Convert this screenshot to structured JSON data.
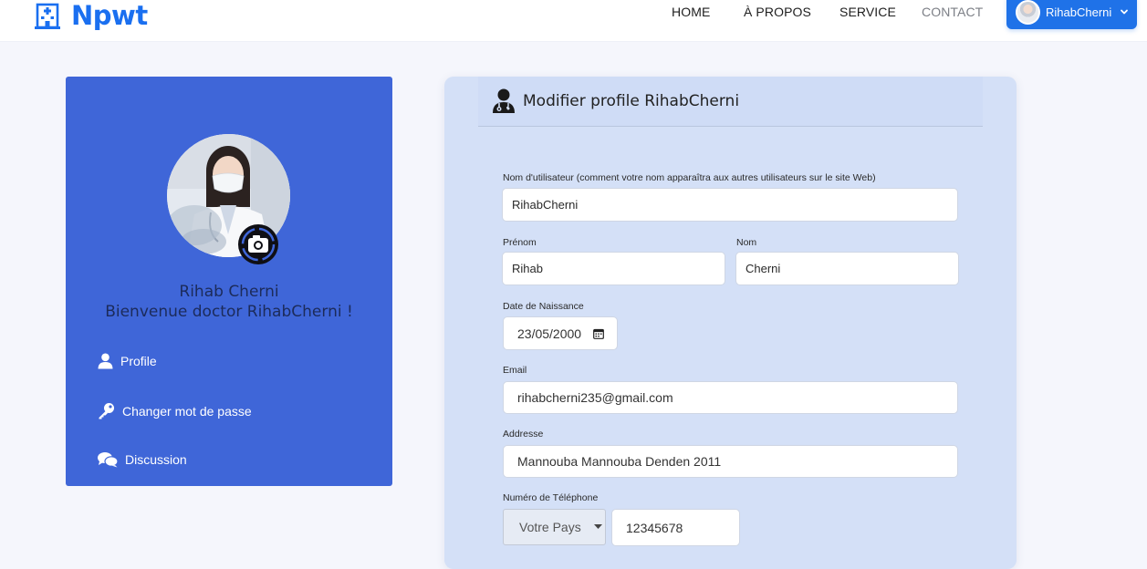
{
  "brand": {
    "name": "Npwt",
    "icon": "hospital-building-icon",
    "color": "#1a6ff0"
  },
  "nav": {
    "links": [
      {
        "label": "HOME"
      },
      {
        "label": "À PROPOS"
      },
      {
        "label": "SERVICE"
      },
      {
        "label": "CONTACT"
      }
    ],
    "user": {
      "name": "RihabCherni",
      "avatar": "user-avatar",
      "chevron": "chevron-down-icon",
      "color": "#1f72e8"
    }
  },
  "sidebar": {
    "background": "#3f66d8",
    "photo": "profile-photo",
    "camera_icon": "camera-icon",
    "name": "Rihab Cherni",
    "welcome": "Bienvenue doctor RihabCherni !",
    "items": [
      {
        "label": "Profile",
        "icon": "user-icon"
      },
      {
        "label": "Changer mot de passe",
        "icon": "key-icon"
      },
      {
        "label": "Discussion",
        "icon": "chat-icon"
      }
    ]
  },
  "form": {
    "title": "Modifier profile RihabCherni",
    "title_icon": "doctor-icon",
    "background": "#d4e0f7",
    "username": {
      "label": "Nom d'utilisateur (comment votre nom apparaîtra aux autres utilisateurs sur le site Web)",
      "value": "RihabCherni"
    },
    "firstname": {
      "label": "Prénom",
      "value": "Rihab"
    },
    "lastname": {
      "label": "Nom",
      "value": "Cherni"
    },
    "birthdate": {
      "label": "Date de Naissance",
      "value": "23/05/2000",
      "icon": "calendar-icon"
    },
    "email": {
      "label": "Email",
      "value": "rihabcherni235@gmail.com"
    },
    "address": {
      "label": "Addresse",
      "value": "Mannouba Mannouba Denden 2011"
    },
    "phone": {
      "label": "Numéro de Téléphone",
      "country_placeholder": "Votre Pays",
      "value": "12345678",
      "caret": "caret-down-icon"
    }
  }
}
